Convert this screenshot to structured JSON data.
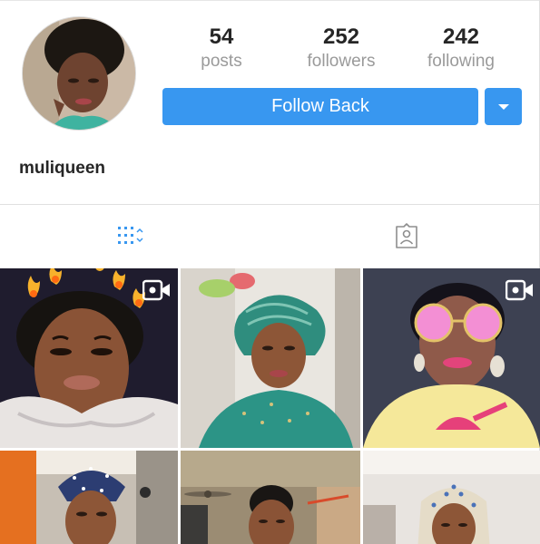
{
  "profile": {
    "username": "muliqueen",
    "stats": [
      {
        "value": "54",
        "label": "posts"
      },
      {
        "value": "252",
        "label": "followers"
      },
      {
        "value": "242",
        "label": "following"
      }
    ],
    "follow_button_label": "Follow Back"
  },
  "tabs": [
    {
      "name": "grid",
      "icon": "grid-icon",
      "active": true
    },
    {
      "name": "tagged",
      "icon": "tagged-portrait-icon",
      "active": false
    }
  ],
  "posts": [
    {
      "row": 1,
      "col": 1,
      "type": "video",
      "filter": "fire-crown"
    },
    {
      "row": 1,
      "col": 2,
      "type": "photo"
    },
    {
      "row": 1,
      "col": 3,
      "type": "video",
      "filter": "pink-sunglasses"
    },
    {
      "row": 2,
      "col": 1,
      "type": "photo"
    },
    {
      "row": 2,
      "col": 2,
      "type": "photo"
    },
    {
      "row": 2,
      "col": 3,
      "type": "photo"
    }
  ],
  "colors": {
    "accent": "#3897f0",
    "text": "#262626",
    "secondary_text": "#9a9a9a",
    "divider": "#e0e0e0"
  }
}
